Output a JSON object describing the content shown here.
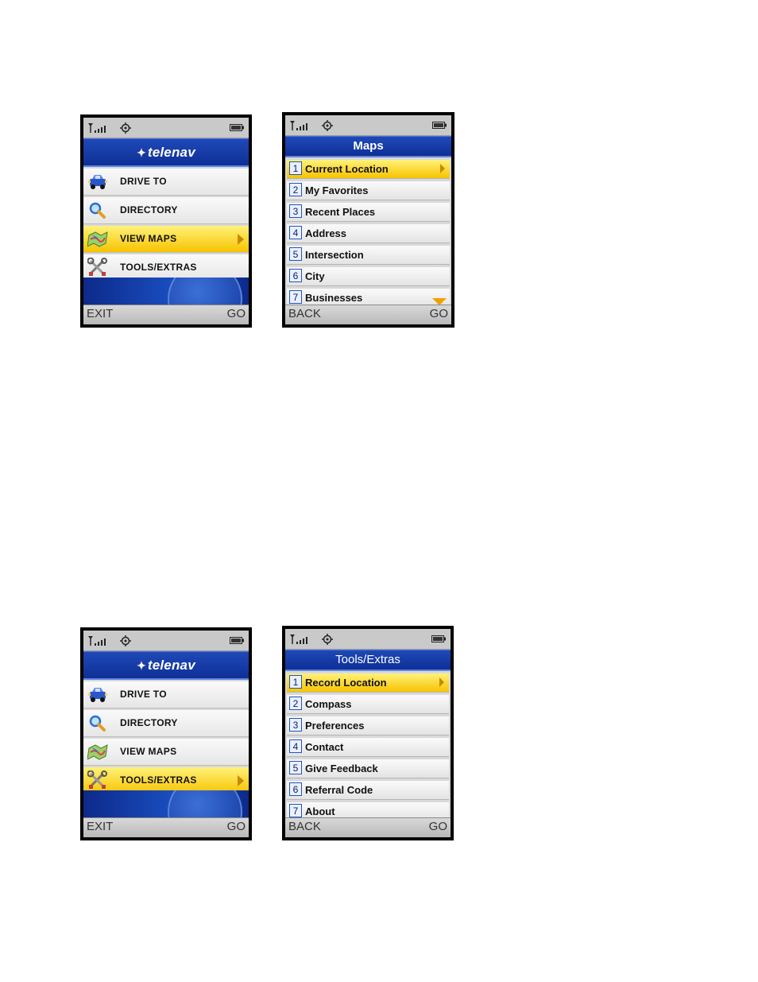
{
  "icons": {
    "signal": "signal-icon",
    "gps": "gps-icon",
    "battery": "battery-icon",
    "drive_to": "car-icon",
    "directory": "magnifier-icon",
    "view_maps": "map-icon",
    "tools_extras": "tools-icon"
  },
  "colors": {
    "title_blue": "#1f49b8",
    "highlight_yellow": "#f7c300",
    "arrow_orange": "#c68a00"
  },
  "main_menu_1": {
    "logo_text": "telenav",
    "items": [
      {
        "label": "DRIVE TO"
      },
      {
        "label": "DIRECTORY"
      },
      {
        "label": "VIEW MAPS"
      },
      {
        "label": "TOOLS/EXTRAS"
      }
    ],
    "left_softkey": "EXIT",
    "right_softkey": "GO"
  },
  "maps_menu": {
    "title": "Maps",
    "items": [
      {
        "num": "1",
        "label": "Current Location"
      },
      {
        "num": "2",
        "label": "My Favorites"
      },
      {
        "num": "3",
        "label": "Recent Places"
      },
      {
        "num": "4",
        "label": "Address"
      },
      {
        "num": "5",
        "label": "Intersection"
      },
      {
        "num": "6",
        "label": "City"
      },
      {
        "num": "7",
        "label": "Businesses"
      }
    ],
    "left_softkey": "BACK",
    "right_softkey": "GO"
  },
  "main_menu_2": {
    "logo_text": "telenav",
    "items": [
      {
        "label": "DRIVE TO"
      },
      {
        "label": "DIRECTORY"
      },
      {
        "label": "VIEW MAPS"
      },
      {
        "label": "TOOLS/EXTRAS"
      }
    ],
    "left_softkey": "EXIT",
    "right_softkey": "GO"
  },
  "tools_menu": {
    "title": "Tools/Extras",
    "items": [
      {
        "num": "1",
        "label": "Record Location"
      },
      {
        "num": "2",
        "label": "Compass"
      },
      {
        "num": "3",
        "label": "Preferences"
      },
      {
        "num": "4",
        "label": "Contact"
      },
      {
        "num": "5",
        "label": "Give Feedback"
      },
      {
        "num": "6",
        "label": "Referral Code"
      },
      {
        "num": "7",
        "label": "About"
      }
    ],
    "left_softkey": "BACK",
    "right_softkey": "GO"
  }
}
